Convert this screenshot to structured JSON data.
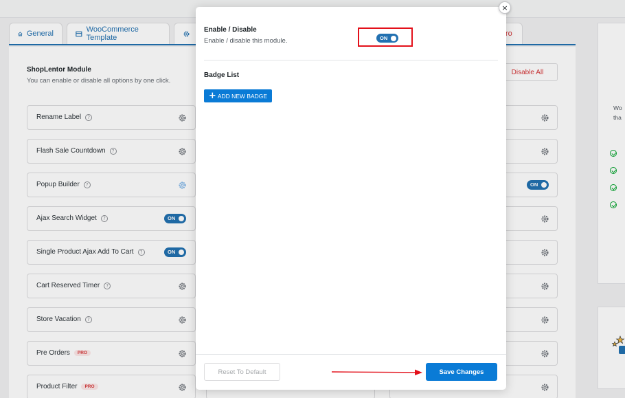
{
  "tabs": [
    {
      "label": "General",
      "icon": "home-icon"
    },
    {
      "label": "WooCommerce Template",
      "icon": "template-icon"
    },
    {
      "label": "",
      "icon": "gear-icon"
    },
    {
      "label": "ro",
      "icon": ""
    }
  ],
  "module": {
    "title": "ShopLentor Module",
    "subtitle": "You can enable or disable all options by one click.",
    "disable_all": "Disable All"
  },
  "cards_left": [
    {
      "label": "Rename Label",
      "state": "gear"
    },
    {
      "label": "Flash Sale Countdown",
      "state": "gear"
    },
    {
      "label": "Popup Builder",
      "state": "gear"
    },
    {
      "label": "Ajax Search Widget",
      "state": "on"
    },
    {
      "label": "Single Product Ajax Add To Cart",
      "state": "on"
    },
    {
      "label": "Cart Reserved Timer",
      "state": "gear"
    },
    {
      "label": "Store Vacation",
      "state": "gear"
    },
    {
      "label": "Pre Orders",
      "state": "gear",
      "badge": "PRO"
    },
    {
      "label": "Product Filter",
      "state": "gear",
      "badge": "PRO"
    }
  ],
  "toggle_label": "ON",
  "side": {
    "lines": [
      "Wo",
      "tha"
    ]
  },
  "modal": {
    "close_symbol": "×",
    "enable_title": "Enable / Disable",
    "enable_subtitle": "Enable / disable this module.",
    "toggle_label": "ON",
    "badge_list_title": "Badge List",
    "add_badge_symbol": "+",
    "add_badge_label": "ADD NEW BADGE",
    "reset_label": "Reset To Default",
    "save_label": "Save Changes"
  },
  "colors": {
    "primary": "#0a7bd6",
    "toggle": "#2271b1",
    "highlight": "#e3101a",
    "pro": "#d63638"
  }
}
